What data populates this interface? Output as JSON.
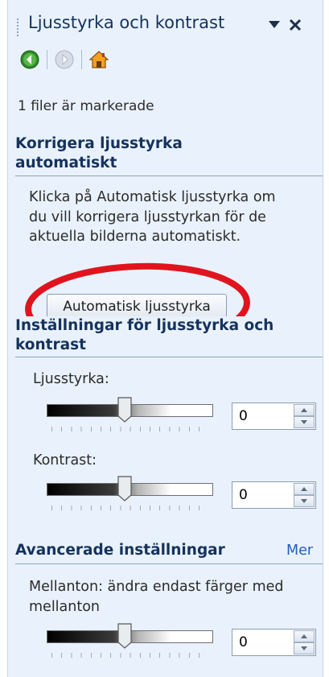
{
  "pane": {
    "title": "Ljusstyrka och kontrast",
    "menu_icon": "dropdown-triangle-icon",
    "close_icon": "close-icon"
  },
  "nav": {
    "back_icon": "back-arrow-icon",
    "forward_icon": "forward-arrow-icon",
    "home_icon": "home-icon"
  },
  "status": "1 filer är markerade",
  "auto_section": {
    "heading_line1": "Korrigera ljusstyrka",
    "heading_line2": "automatiskt",
    "desc_line1": "Klicka på Automatisk ljusstyrka om",
    "desc_line2": "du vill korrigera ljusstyrkan för de",
    "desc_line3": "aktuella bilderna automatiskt.",
    "button_label": "Automatisk ljusstyrka",
    "highlight_color": "#e0141e"
  },
  "settings_section": {
    "heading_line1": "Inställningar för ljusstyrka och",
    "heading_line2": "kontrast",
    "brightness_label": "Ljusstyrka:",
    "brightness_value": "0",
    "contrast_label": "Kontrast:",
    "contrast_value": "0"
  },
  "advanced_section": {
    "heading": "Avancerade inställningar",
    "more_link": "Mer",
    "midtones_line1": "Mellanton: ändra endast färger med",
    "midtones_line2": "mellanton",
    "midtones_value": "0"
  },
  "colors": {
    "pane_bg": "#e9f2fc",
    "heading": "#15325c",
    "link": "#1f5fbf"
  }
}
